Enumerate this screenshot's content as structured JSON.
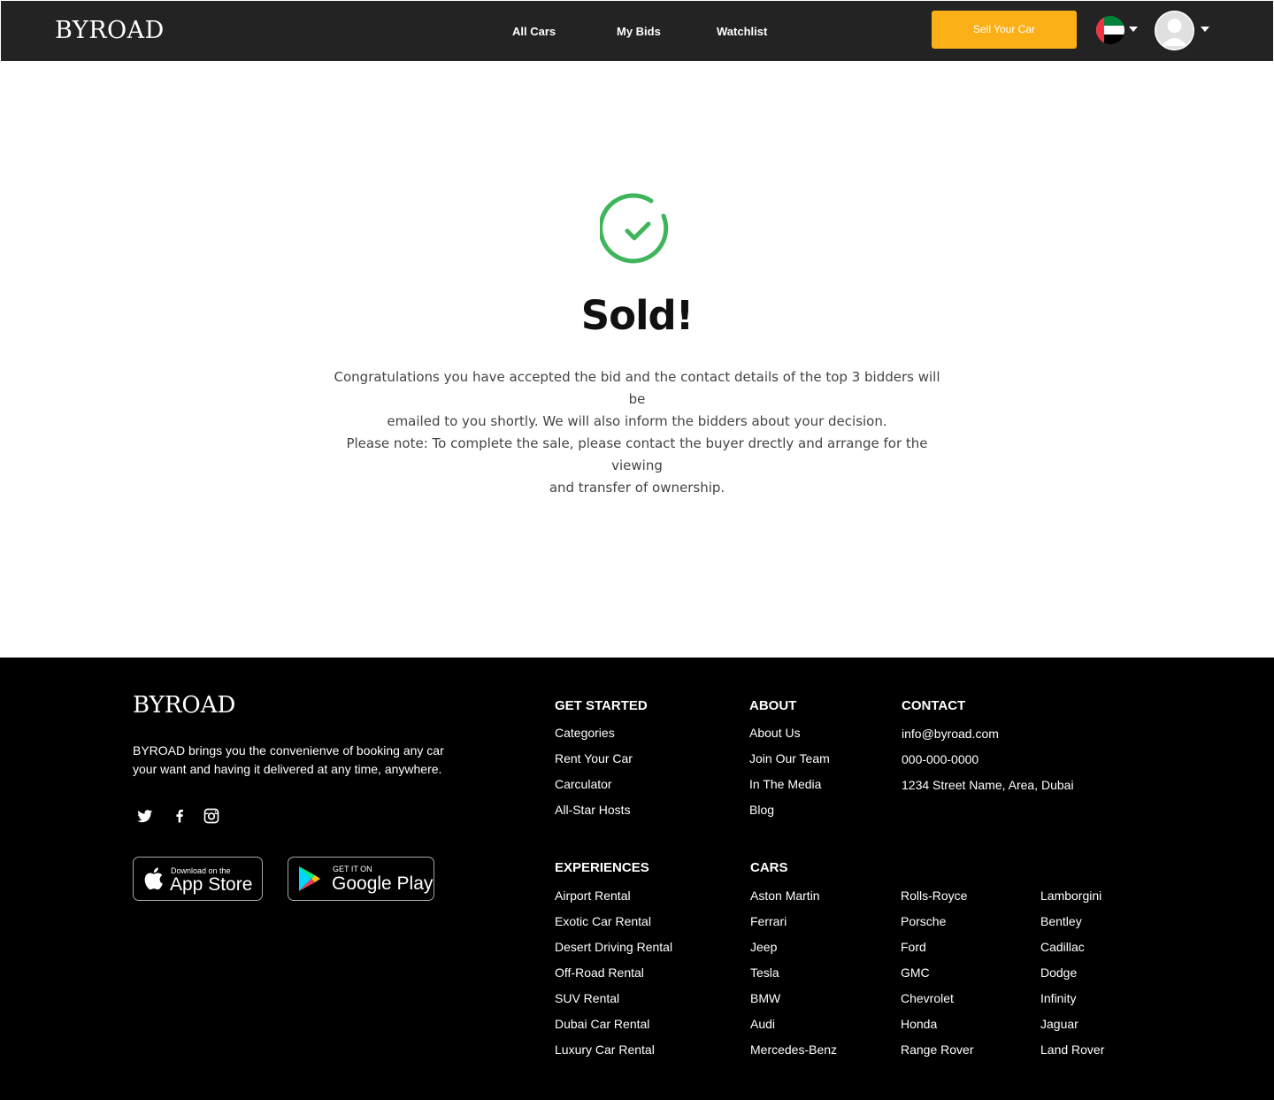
{
  "header": {
    "logo": "BYROAD",
    "nav": [
      "All Cars",
      "My Bids",
      "Watchlist"
    ],
    "sell_button": "Sell Your Car",
    "accent_color": "#fbb018"
  },
  "main": {
    "title": "Sold!",
    "paragraph1_line1": "Congratulations you have accepted the bid and the contact details of the top 3 bidders will be",
    "paragraph1_line2": "emailed to you shortly. We will also inform the bidders about your decision.",
    "paragraph2_line1": "Please note: To complete the sale, please contact the buyer drectly and arrange for the viewing",
    "paragraph2_line2": "and transfer of ownership.",
    "success_color": "#3fb55b"
  },
  "footer": {
    "logo": "BYROAD",
    "description_line1": "BYROAD brings you the convenienve of booking any car",
    "description_line2": "your want and having it delivered at any time, anywhere.",
    "social_icons": [
      "twitter-icon",
      "facebook-icon",
      "instagram-icon"
    ],
    "app_store": {
      "small": "Download on the",
      "big": "App Store"
    },
    "google_play": {
      "small": "GET IT ON",
      "big": "Google Play"
    },
    "get_started": {
      "heading": "GET STARTED",
      "links": [
        "Categories",
        "Rent Your Car",
        "Carculator",
        "All-Star Hosts"
      ]
    },
    "about": {
      "heading": "ABOUT",
      "links": [
        "About Us",
        "Join Our Team",
        "In The Media",
        "Blog"
      ]
    },
    "contact": {
      "heading": "CONTACT",
      "email": "info@byroad.com",
      "phone": "000-000-0000",
      "address": "1234 Street Name, Area, Dubai"
    },
    "experiences": {
      "heading": "EXPERIENCES",
      "links": [
        "Airport Rental",
        "Exotic Car Rental",
        "Desert Driving Rental",
        "Off-Road Rental",
        "SUV Rental",
        "Dubai Car Rental",
        "Luxury Car Rental"
      ]
    },
    "cars": {
      "heading": "CARS",
      "col1": [
        "Aston Martin",
        "Ferrari",
        "Jeep",
        "Tesla",
        "BMW",
        "Audi",
        "Mercedes-Benz"
      ],
      "col2": [
        "Rolls-Royce",
        "Porsche",
        "Ford",
        "GMC",
        "Chevrolet",
        "Honda",
        "Range Rover"
      ],
      "col3": [
        "Lamborgini",
        "Bentley",
        "Cadillac",
        "Dodge",
        "Infinity",
        "Jaguar",
        "Land Rover"
      ]
    }
  }
}
